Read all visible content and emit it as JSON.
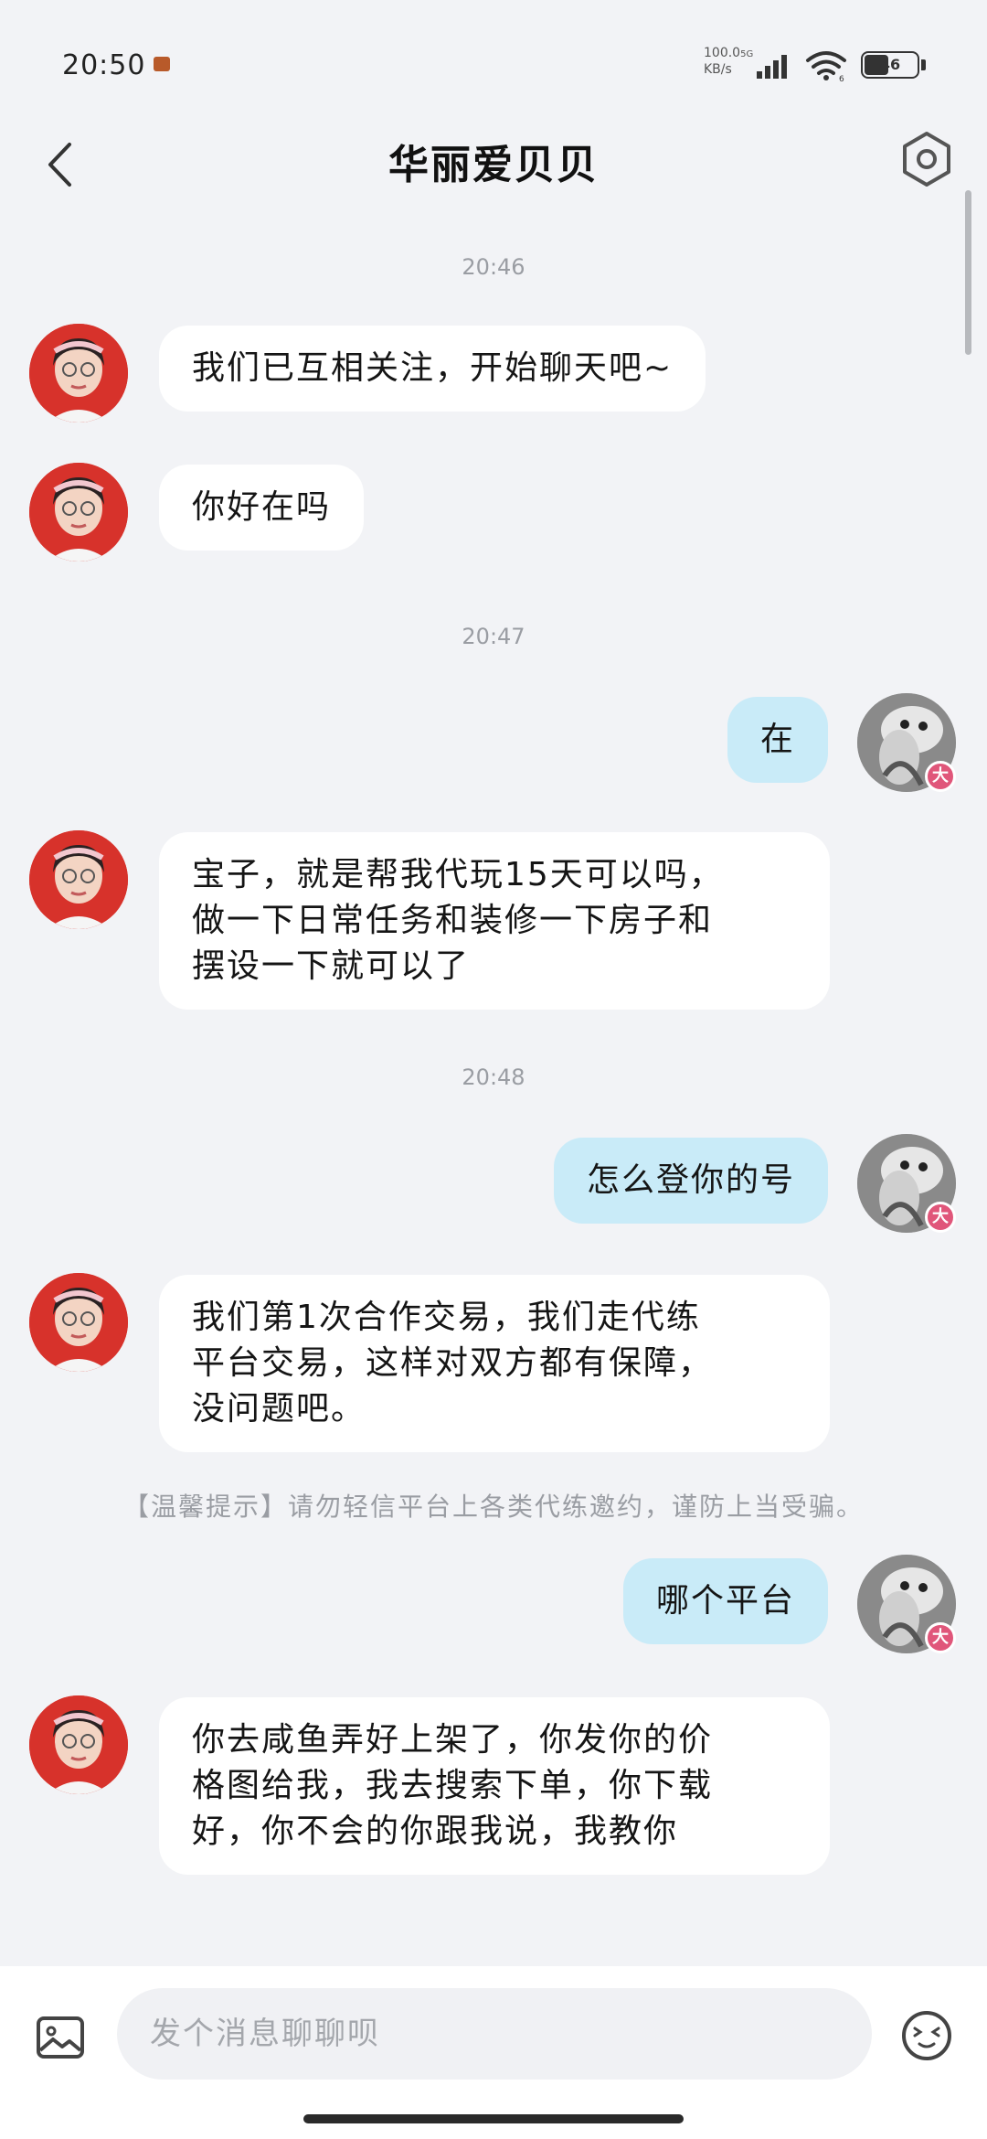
{
  "status_bar": {
    "time": "20:50",
    "net_speed_value": "100.0",
    "net_speed_unit": "KB/s",
    "network_type": "5G",
    "wifi_label": "6",
    "battery_level": "46"
  },
  "header": {
    "title": "华丽爱贝贝"
  },
  "messages": [
    {
      "kind": "timestamp",
      "text": "20:46"
    },
    {
      "kind": "other",
      "text": "我们已互相关注，开始聊天吧~"
    },
    {
      "kind": "other",
      "text": "你好在吗"
    },
    {
      "kind": "timestamp",
      "text": "20:47"
    },
    {
      "kind": "self",
      "text": "在",
      "badge": "大"
    },
    {
      "kind": "other",
      "lines": [
        "宝子，就是帮我代玩15天可以吗，",
        "做一下日常任务和装修一下房子和",
        "摆设一下就可以了"
      ]
    },
    {
      "kind": "timestamp",
      "text": "20:48"
    },
    {
      "kind": "self",
      "text": "怎么登你的号",
      "badge": "大"
    },
    {
      "kind": "other",
      "lines": [
        "我们第1次合作交易，我们走代练",
        "平台交易，这样对双方都有保障，",
        "没问题吧。"
      ]
    },
    {
      "kind": "notice",
      "text": "【温馨提示】请勿轻信平台上各类代练邀约，谨防上当受骗。"
    },
    {
      "kind": "self",
      "text": "哪个平台",
      "badge": "大"
    },
    {
      "kind": "other",
      "lines": [
        "你去咸鱼弄好上架了，你发你的价",
        "格图给我，我去搜索下单，你下载",
        "好，你不会的你跟我说，我教你"
      ]
    }
  ],
  "input": {
    "placeholder": "发个消息聊聊呗"
  },
  "icons": {
    "back": "chevron-left-icon",
    "settings": "settings-hexagon-icon",
    "image": "image-icon",
    "emoji": "emoji-icon"
  }
}
